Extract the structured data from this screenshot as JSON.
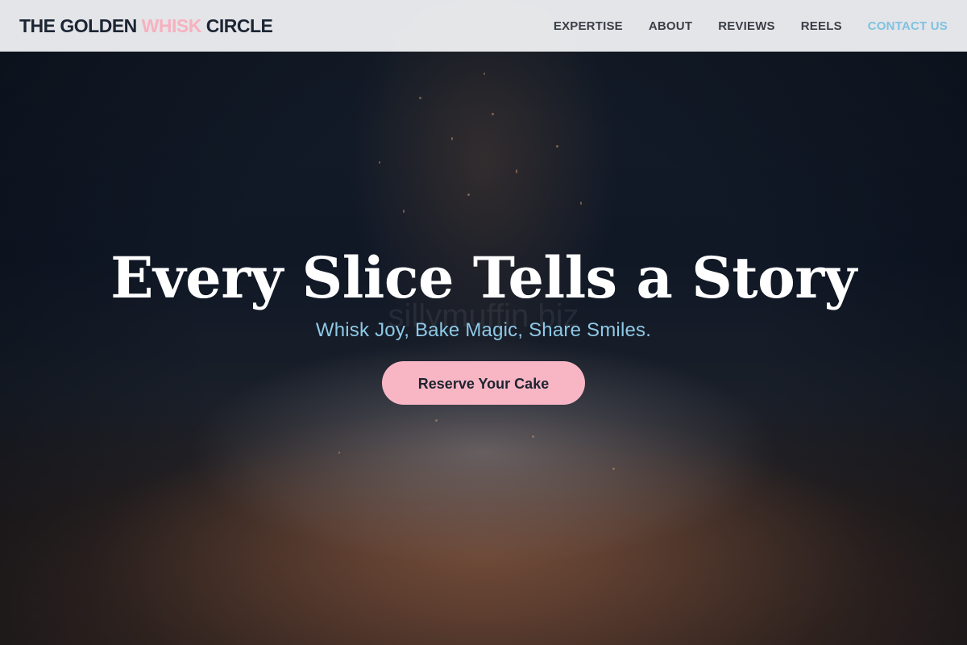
{
  "header": {
    "brand_part1": "THE GOLDEN ",
    "brand_accent": "WHISK",
    "brand_part2": " CIRCLE",
    "nav": [
      {
        "label": "EXPERTISE"
      },
      {
        "label": "ABOUT"
      },
      {
        "label": "REVIEWS"
      },
      {
        "label": "REELS"
      },
      {
        "label": "CONTACT US",
        "active": true
      }
    ]
  },
  "hero": {
    "title": "Every Slice Tells a Story",
    "subtitle": "Whisk Joy, Bake Magic, Share Smiles.",
    "cta_label": "Reserve Your Cake",
    "watermark": "sillymuffin.biz"
  },
  "colors": {
    "accent_pink": "#f8b6c5",
    "accent_blue": "#8ec9e6",
    "dark_text": "#1c2533"
  }
}
